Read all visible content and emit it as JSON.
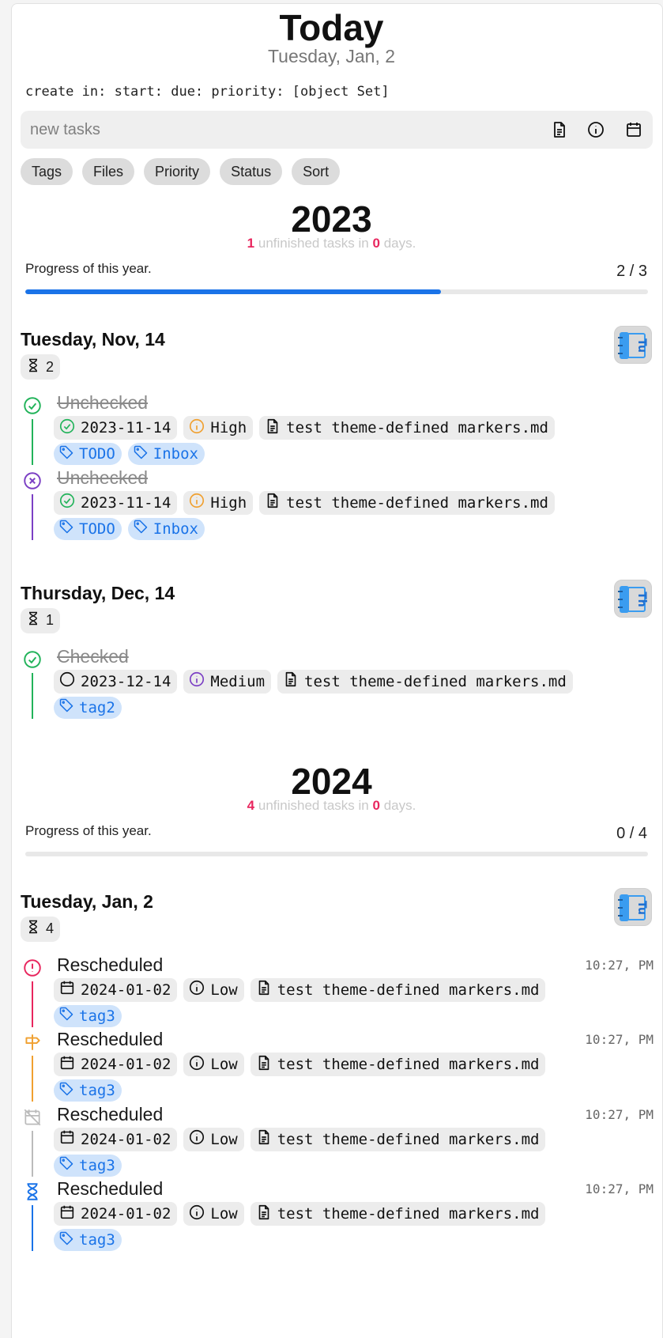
{
  "header": {
    "title": "Today",
    "date": "Tuesday, Jan, 2"
  },
  "debug_line": "create in: start: due: priority: [object Set]",
  "new_task": {
    "placeholder": "new tasks"
  },
  "filters": [
    "Tags",
    "Files",
    "Priority",
    "Status",
    "Sort"
  ],
  "colors": {
    "accent": "#1a73e8",
    "highlight": "#e8265e",
    "done": "#22b35a",
    "cancelled": "#7b3fc4",
    "priority_high": "#f0a030",
    "overdue": "#e8265e",
    "scheduled": "#f0a030",
    "unplanned": "#bbbbbb",
    "ongoing": "#1a73e8",
    "tag_bg": "#cfe3fb"
  },
  "years": [
    {
      "year": "2023",
      "unfinished_count": "1",
      "unfinished_text": "unfinished tasks in",
      "days_count": "0",
      "days_text": "days.",
      "progress_label": "Progress of this year.",
      "progress_text": "2 / 3",
      "progress_fraction": 0.667,
      "days": [
        {
          "title": "Tuesday, Nov, 14",
          "count": "2",
          "badge_icon": "tuesday-badge-icon",
          "tasks": [
            {
              "status": "done",
              "title": "Unchecked",
              "date_icon": "check-circle-icon",
              "date": "2023-11-14",
              "priority": "High",
              "file": "test theme-defined markers.md",
              "tags": [
                "TODO",
                "Inbox"
              ]
            },
            {
              "status": "cancelled",
              "title": "Unchecked",
              "date_icon": "check-circle-icon",
              "date": "2023-11-14",
              "priority": "High",
              "file": "test theme-defined markers.md",
              "tags": [
                "TODO",
                "Inbox"
              ]
            }
          ]
        },
        {
          "title": "Thursday, Dec, 14",
          "count": "1",
          "badge_icon": "thursday-badge-icon",
          "tasks": [
            {
              "status": "done",
              "title": "Checked",
              "date_icon": "circle-icon",
              "date": "2023-12-14",
              "priority": "Medium",
              "file": "test theme-defined markers.md",
              "tags": [
                "tag2"
              ]
            }
          ]
        }
      ]
    },
    {
      "year": "2024",
      "unfinished_count": "4",
      "unfinished_text": "unfinished tasks in",
      "days_count": "0",
      "days_text": "days.",
      "progress_label": "Progress of this year.",
      "progress_text": "0 / 4",
      "progress_fraction": 0,
      "days": [
        {
          "title": "Tuesday, Jan, 2",
          "count": "4",
          "badge_icon": "tuesday-badge-icon",
          "tasks": [
            {
              "status": "overdue",
              "title": "Rescheduled",
              "time": "10:27, PM",
              "date_icon": "calendar-icon",
              "date": "2024-01-02",
              "priority": "Low",
              "file": "test theme-defined markers.md",
              "tags": [
                "tag3"
              ]
            },
            {
              "status": "scheduled",
              "title": "Rescheduled",
              "time": "10:27, PM",
              "date_icon": "calendar-icon",
              "date": "2024-01-02",
              "priority": "Low",
              "file": "test theme-defined markers.md",
              "tags": [
                "tag3"
              ]
            },
            {
              "status": "unplanned",
              "title": "Rescheduled",
              "time": "10:27, PM",
              "date_icon": "calendar-icon",
              "date": "2024-01-02",
              "priority": "Low",
              "file": "test theme-defined markers.md",
              "tags": [
                "tag3"
              ]
            },
            {
              "status": "ongoing",
              "title": "Rescheduled",
              "time": "10:27, PM",
              "date_icon": "calendar-icon",
              "date": "2024-01-02",
              "priority": "Low",
              "file": "test theme-defined markers.md",
              "tags": [
                "tag3"
              ]
            }
          ]
        }
      ]
    }
  ]
}
